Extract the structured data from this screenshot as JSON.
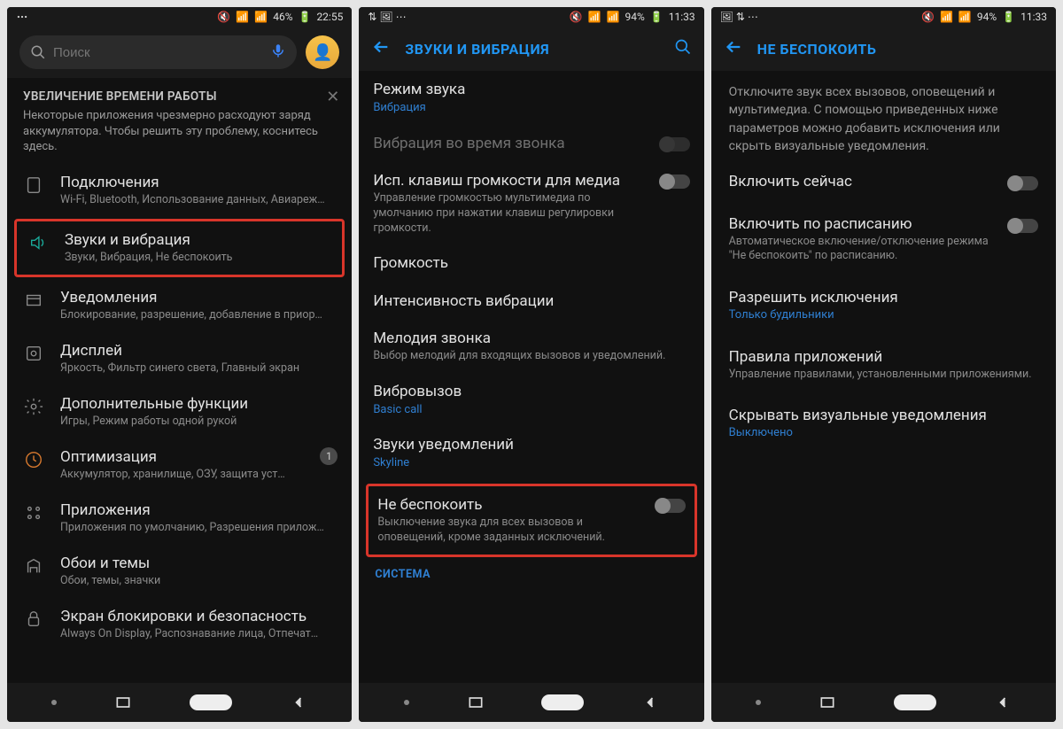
{
  "screens": [
    {
      "status": {
        "battery": "46%",
        "time": "22:55"
      },
      "search": {
        "placeholder": "Поиск"
      },
      "tip": {
        "title": "УВЕЛИЧЕНИЕ ВРЕМЕНИ РАБОТЫ",
        "body": "Некоторые приложения чрезмерно расходуют заряд аккумулятора. Чтобы решить эту проблему, коснитесь здесь."
      },
      "items": [
        {
          "label": "Подключения",
          "sub": "Wi-Fi, Bluetooth, Использование данных, Авиареж…"
        },
        {
          "label": "Звуки и вибрация",
          "sub": "Звуки, Вибрация, Не беспокоить"
        },
        {
          "label": "Уведомления",
          "sub": "Блокирование, разрешение, добавление в приор…"
        },
        {
          "label": "Дисплей",
          "sub": "Яркость, Фильтр синего света, Главный экран"
        },
        {
          "label": "Дополнительные функции",
          "sub": "Игры, Режим работы одной рукой"
        },
        {
          "label": "Оптимизация",
          "sub": "Аккумулятор, хранилище, ОЗУ, защита уст…",
          "badge": "1"
        },
        {
          "label": "Приложения",
          "sub": "Приложения по умолчанию, Разрешения прилож…"
        },
        {
          "label": "Обои и темы",
          "sub": "Обои, темы, значки"
        },
        {
          "label": "Экран блокировки и безопасность",
          "sub": "Always On Display, Распознавание лица, Отпечат…"
        }
      ]
    },
    {
      "status": {
        "battery": "94%",
        "time": "11:33"
      },
      "header": "ЗВУКИ И ВИБРАЦИЯ",
      "items": [
        {
          "label": "Режим звука",
          "blue": "Вибрация"
        },
        {
          "label": "Вибрация во время звонка",
          "disabled": true,
          "toggle": true
        },
        {
          "label": "Исп. клавиш громкости для медиа",
          "sub": "Управление громкостью мультимедиа по умолчанию при нажатии клавиш регулировки громкости.",
          "toggle": true
        },
        {
          "label": "Громкость"
        },
        {
          "label": "Интенсивность вибрации"
        },
        {
          "label": "Мелодия звонка",
          "sub": "Выбор мелодий для входящих вызовов и уведомлений."
        },
        {
          "label": "Вибровызов",
          "blue": "Basic call"
        },
        {
          "label": "Звуки уведомлений",
          "blue": "Skyline"
        },
        {
          "label": "Не беспокоить",
          "sub": "Выключение звука для всех вызовов и оповещений, кроме заданных исключений.",
          "toggle": true
        }
      ],
      "section": "СИСТЕМА"
    },
    {
      "status": {
        "battery": "94%",
        "time": "11:33"
      },
      "header": "НЕ БЕСПОКОИТЬ",
      "intro": "Отключите звук всех вызовов, оповещений и мультимедиа. С помощью приведенных ниже параметров можно добавить исключения или скрыть визуальные уведомления.",
      "items": [
        {
          "label": "Включить сейчас",
          "toggle": true
        },
        {
          "label": "Включить по расписанию",
          "sub": "Автоматическое включение/отключение режима \"Не беспокоить\" по расписанию.",
          "toggle": true
        },
        {
          "label": "Разрешить исключения",
          "blue": "Только будильники"
        },
        {
          "label": "Правила приложений",
          "sub": "Управление правилами, установленными приложениями."
        },
        {
          "label": "Скрывать визуальные уведомления",
          "blue": "Выключено"
        }
      ]
    }
  ]
}
